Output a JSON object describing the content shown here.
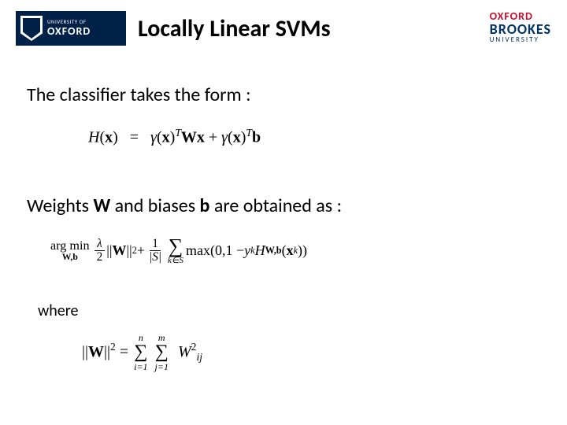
{
  "logos": {
    "oxford_line1": "UNIVERSITY OF",
    "oxford_line2": "OXFORD",
    "brookes_line1": "OXFORD",
    "brookes_line2": "BROOKES",
    "brookes_line3": "UNIVERSITY"
  },
  "slide": {
    "title": "Locally Linear SVMs",
    "line1": "The classifier takes the form :",
    "line2_pre": "Weights ",
    "line2_w": "W",
    "line2_mid": " and biases ",
    "line2_b": "b",
    "line2_post": " are obtained as :",
    "where": "where"
  },
  "equations": {
    "eq1": {
      "H": "H",
      "lp": "(",
      "x": "x",
      "rp": ")",
      "eq": " = ",
      "g": "γ",
      "T": "T",
      "W": "W",
      "plus": " + ",
      "b": "b"
    },
    "eq2": {
      "argmin": "arg min",
      "wb": "W,b",
      "lambda": "λ",
      "two": "2",
      "W": "W",
      "sq": "2",
      "plus": " + ",
      "one": "1",
      "Sabs": "|S|",
      "kS": "k∈S",
      "max": "max",
      "zero": "0",
      "oneminus": "1 − ",
      "y": "y",
      "k": "k",
      "H": "H",
      "Wb": "W,b",
      "x": "x"
    },
    "eq3": {
      "W": "W",
      "sq": "2",
      "eq": " = ",
      "sum_i_top": "n",
      "sum_i_bot": "i=1",
      "sum_j_top": "m",
      "sum_j_bot": "j=1",
      "Wi": "W",
      "ij": "ij"
    }
  }
}
